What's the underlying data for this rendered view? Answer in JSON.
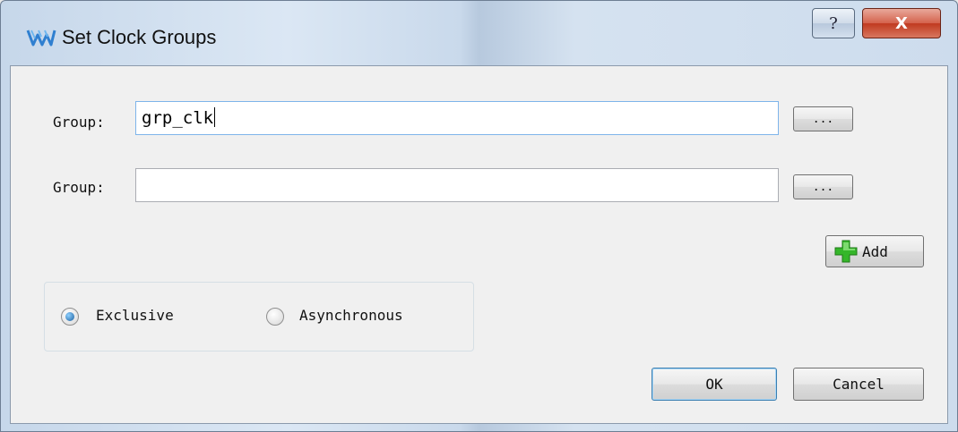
{
  "window": {
    "title": "Set Clock Groups",
    "help_glyph": "?",
    "close_glyph": "X"
  },
  "groups": [
    {
      "label": "Group:",
      "value": "grp_clk",
      "browse_label": "..."
    },
    {
      "label": "Group:",
      "value": "",
      "browse_label": "..."
    }
  ],
  "add_button": {
    "label": "Add",
    "icon": "green-plus-icon"
  },
  "mode": {
    "options": [
      {
        "label": "Exclusive",
        "checked": true
      },
      {
        "label": "Asynchronous",
        "checked": false
      }
    ]
  },
  "footer": {
    "ok_label": "OK",
    "cancel_label": "Cancel"
  },
  "colors": {
    "accent": "#3c7fb1",
    "close": "#c0391f",
    "plus": "#35b62a"
  }
}
